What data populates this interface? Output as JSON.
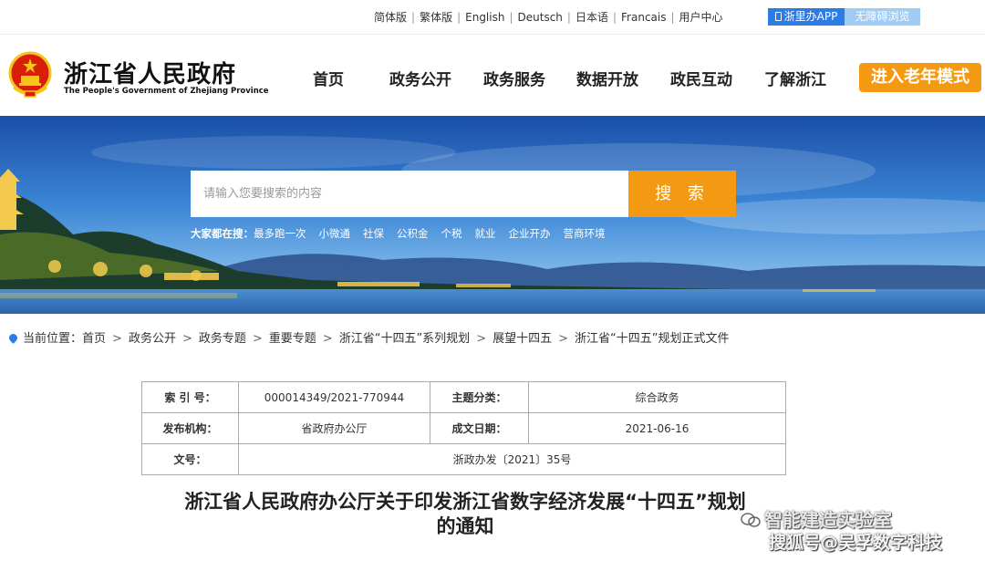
{
  "topbar": {
    "languages": [
      "简体版",
      "繁体版",
      "English",
      "Deutsch",
      "日本语",
      "Francais",
      "用户中心"
    ],
    "app_button": "浙里办APP",
    "accessibility_button": "无障碍浏览"
  },
  "header": {
    "title": "浙江省人民政府",
    "subtitle": "The People's Government of Zhejiang Province",
    "nav": [
      "首页",
      "政务公开",
      "政务服务",
      "数据开放",
      "政民互动",
      "了解浙江"
    ],
    "elder_mode": "进入老年模式"
  },
  "search": {
    "placeholder": "请输入您要搜索的内容",
    "button": "搜 索",
    "hot_label": "大家都在搜：",
    "hot_keywords": [
      "最多跑一次",
      "小微通",
      "社保",
      "公积金",
      "个税",
      "就业",
      "企业开办",
      "营商环境"
    ]
  },
  "breadcrumb": {
    "label": "当前位置：",
    "items": [
      "首页",
      "政务公开",
      "政务专题",
      "重要专题",
      "浙江省“十四五”系列规划",
      "展望十四五",
      "浙江省“十四五”规划正式文件"
    ]
  },
  "doc_info": {
    "index_label": "索 引 号：",
    "index_value": "000014349/2021-770944",
    "topic_label": "主题分类：",
    "topic_value": "综合政务",
    "issuer_label": "发布机构：",
    "issuer_value": "省政府办公厅",
    "date_label": "成文日期：",
    "date_value": "2021-06-16",
    "docno_label": "文号：",
    "docno_value": "浙政办发〔2021〕35号"
  },
  "document": {
    "title_line1": "浙江省人民政府办公厅关于印发浙江省数字经济发展“十四五”规划",
    "title_line2": "的通知"
  },
  "watermark": {
    "line1": "智能建造实验室",
    "line2": "搜狐号@吴孚数字科技"
  },
  "colors": {
    "accent_orange": "#f39a12",
    "primary_blue": "#2d7be5"
  }
}
